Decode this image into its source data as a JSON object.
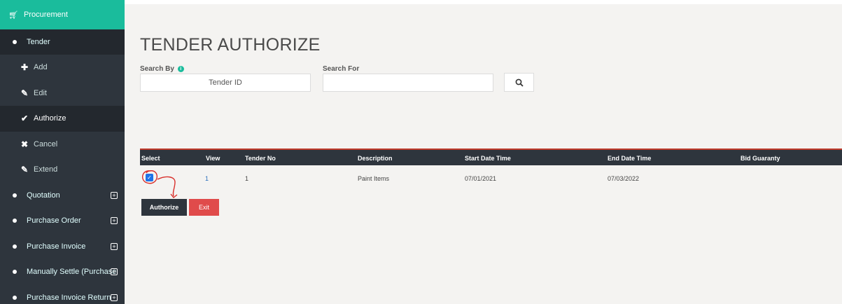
{
  "sidebar": {
    "header": {
      "label": "Procurement",
      "icon": "cart-icon"
    },
    "items": [
      {
        "label": "Tender",
        "kind": "section"
      },
      {
        "label": "Add",
        "icon": "plus-icon"
      },
      {
        "label": "Edit",
        "icon": "edit-icon"
      },
      {
        "label": "Authorize",
        "icon": "check-icon"
      },
      {
        "label": "Cancel",
        "icon": "close-icon"
      },
      {
        "label": "Extend",
        "icon": "edit-icon"
      },
      {
        "label": "Quotation",
        "expand": "⊞"
      },
      {
        "label": "Purchase Order",
        "expand": "⊞"
      },
      {
        "label": "Purchase Invoice",
        "expand": "⊞"
      },
      {
        "label": "Manually Settle (Purchase",
        "expand": "⊞"
      },
      {
        "label": "Purchase Invoice Return",
        "expand": "⊞"
      }
    ]
  },
  "page": {
    "title": "TENDER AUTHORIZE",
    "search_by_label": "Search By",
    "search_by_value": "Tender ID",
    "search_for_label": "Search For",
    "search_for_value": ""
  },
  "table": {
    "columns": [
      "Select",
      "View",
      "Tender No",
      "Description",
      "Start Date Time",
      "End Date Time",
      "Bid Guaranty"
    ],
    "rows": [
      {
        "selected": true,
        "view": "1",
        "tender_no": "1",
        "description": "Paint Items",
        "start": "07/01/2021",
        "end": "07/03/2022",
        "bid": ""
      }
    ]
  },
  "actions": {
    "authorize": "Authorize",
    "exit": "Exit"
  },
  "colors": {
    "sidebar": "#2e353d",
    "accent": "#1abc9c",
    "danger": "#e04b4b",
    "annotation": "#d9302c"
  }
}
